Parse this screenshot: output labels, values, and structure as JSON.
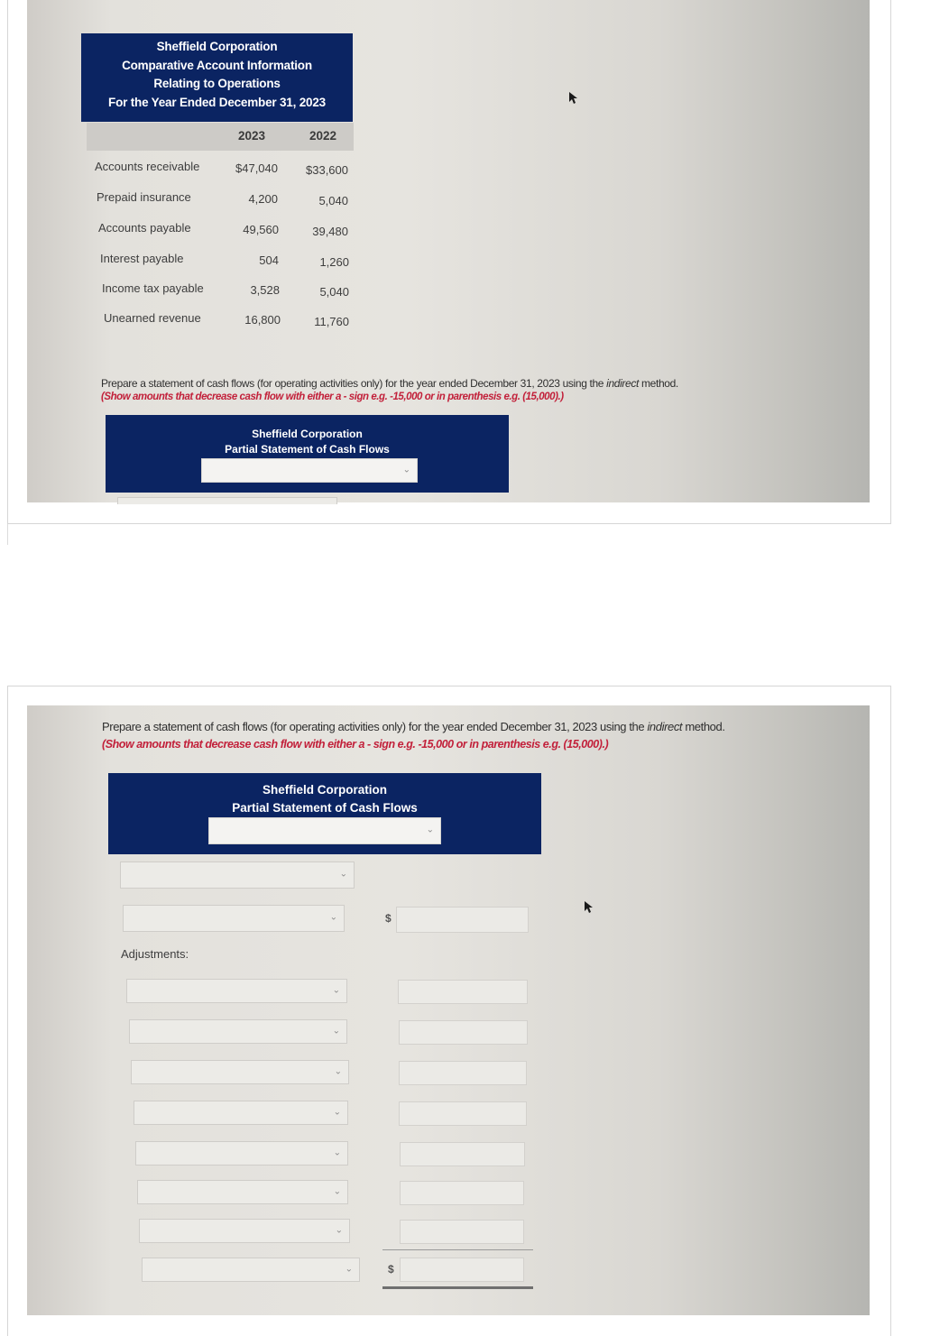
{
  "top_screenshot": {
    "header": {
      "lines": [
        "Sheffield Corporation",
        "Comparative Account Information",
        "Relating to Operations",
        "For the Year Ended December 31, 2023"
      ]
    },
    "table": {
      "columns": [
        "2023",
        "2022"
      ],
      "rows": [
        {
          "label": "Accounts receivable",
          "y2023": "$47,040",
          "y2022": "$33,600"
        },
        {
          "label": "Prepaid insurance",
          "y2023": "4,200",
          "y2022": "5,040"
        },
        {
          "label": "Accounts payable",
          "y2023": "49,560",
          "y2022": "39,480"
        },
        {
          "label": "Interest payable",
          "y2023": "504",
          "y2022": "1,260"
        },
        {
          "label": "Income tax payable",
          "y2023": "3,528",
          "y2022": "5,040"
        },
        {
          "label": "Unearned revenue",
          "y2023": "16,800",
          "y2022": "11,760"
        }
      ]
    },
    "instruction": {
      "main_before": "Prepare a statement of cash flows (for operating activities only) for the year ended December 31, 2023 using the ",
      "main_em": "indirect",
      "main_after": " method.",
      "note": "(Show amounts that decrease cash flow with either a - sign e.g. -15,000 or in parenthesis e.g. (15,000).)"
    },
    "statement": {
      "company": "Sheffield Corporation",
      "title": "Partial Statement of Cash Flows",
      "period_select": {
        "value": "",
        "icon": "chevron-down-icon"
      }
    }
  },
  "bottom_screenshot": {
    "instruction": {
      "main_before": "Prepare a statement of cash flows (for operating activities only) for the year ended December 31, 2023 using the ",
      "main_em": "indirect",
      "main_after": " method.",
      "note": "(Show amounts that decrease cash flow with either a - sign e.g. -15,000 or in parenthesis e.g. (15,000).)"
    },
    "statement": {
      "company": "Sheffield Corporation",
      "title": "Partial Statement of Cash Flows",
      "period_select": {
        "value": "",
        "icon": "chevron-down-icon"
      },
      "section_select": {
        "value": ""
      },
      "net_income_row": {
        "select_value": "",
        "currency": "$",
        "amount": ""
      },
      "adjustments_label": "Adjustments:",
      "adjustment_rows": [
        {
          "select_value": "",
          "amount": ""
        },
        {
          "select_value": "",
          "amount": ""
        },
        {
          "select_value": "",
          "amount": ""
        },
        {
          "select_value": "",
          "amount": ""
        },
        {
          "select_value": "",
          "amount": ""
        },
        {
          "select_value": "",
          "amount": ""
        },
        {
          "select_value": "",
          "amount": ""
        }
      ],
      "total_row": {
        "select_value": "",
        "currency": "$",
        "amount": ""
      }
    }
  },
  "colors": {
    "header_navy": "#0b2462",
    "note_red": "#c2203a"
  }
}
